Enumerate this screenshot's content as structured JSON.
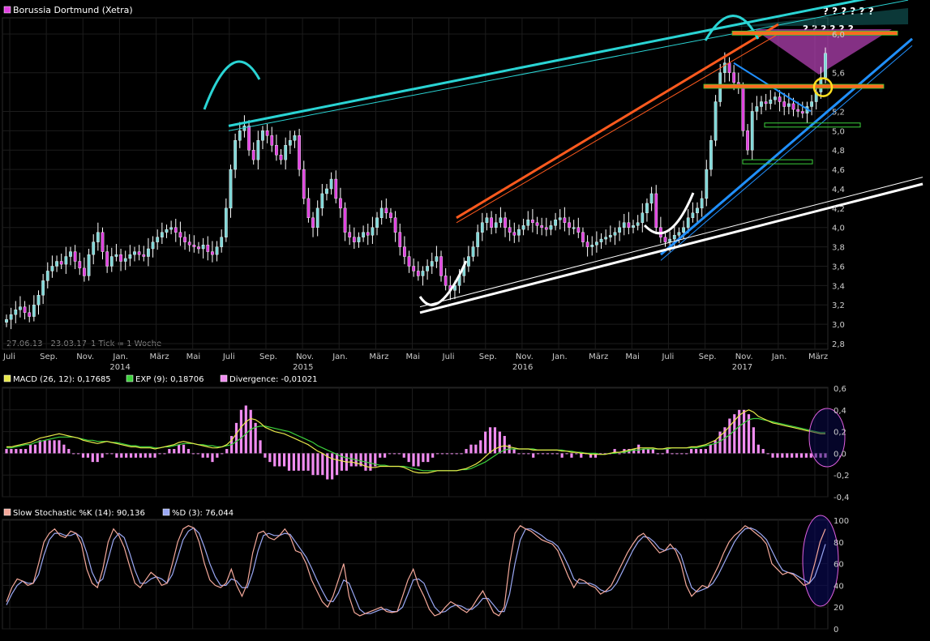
{
  "chart_data": [
    {
      "type": "candlestick",
      "title": "Borussia Dortmund (Xetra)",
      "range_label": "27.06.13 - 23.03.17",
      "tick_label": "1 Tick = 1 Woche",
      "ylim": [
        2.8,
        6.1
      ],
      "y_ticks": [
        "2,8",
        "3,0",
        "3,2",
        "3,4",
        "3,6",
        "3,8",
        "4,0",
        "4,2",
        "4,4",
        "4,6",
        "4,8",
        "5,0",
        "5,2",
        "5,6",
        "6,0"
      ],
      "x_ticks": [
        "Juli",
        "Sep.",
        "Nov.",
        "Jan.",
        "März",
        "Mai",
        "Juli",
        "Sep.",
        "Nov.",
        "Jan.",
        "März",
        "Mai",
        "Juli",
        "Sep.",
        "Nov.",
        "Jan.",
        "März",
        "Mai",
        "Juli",
        "Sep.",
        "Nov.",
        "Jan.",
        "März"
      ],
      "year_labels": [
        {
          "label": "2014",
          "tick": 3
        },
        {
          "label": "2015",
          "tick": 8
        },
        {
          "label": "2016",
          "tick": 14
        },
        {
          "label": "2017",
          "tick": 20
        }
      ],
      "annotations": [
        "? ? ? ? ? ?",
        "? ? ? ? ? ?"
      ],
      "colors": {
        "up": "#7fd8d8",
        "down": "#e040e0",
        "wick": "#ffffff"
      },
      "series": [
        {
          "name": "close",
          "values": [
            3.05,
            3.1,
            3.15,
            3.18,
            3.12,
            3.08,
            3.2,
            3.3,
            3.45,
            3.55,
            3.6,
            3.65,
            3.62,
            3.7,
            3.75,
            3.65,
            3.58,
            3.5,
            3.72,
            3.85,
            3.95,
            3.75,
            3.6,
            3.7,
            3.72,
            3.65,
            3.68,
            3.72,
            3.75,
            3.72,
            3.7,
            3.78,
            3.85,
            3.9,
            3.95,
            3.98,
            4.0,
            3.95,
            3.9,
            3.85,
            3.82,
            3.8,
            3.78,
            3.82,
            3.75,
            3.72,
            3.8,
            3.9,
            4.2,
            4.6,
            4.9,
            5.0,
            5.05,
            4.8,
            4.7,
            4.9,
            5.0,
            4.95,
            4.85,
            4.75,
            4.7,
            4.85,
            4.9,
            4.95,
            4.6,
            4.3,
            4.1,
            4.0,
            4.2,
            4.35,
            4.4,
            4.5,
            4.3,
            4.2,
            3.95,
            3.9,
            3.85,
            3.9,
            3.95,
            3.92,
            4.0,
            4.1,
            4.2,
            4.15,
            4.1,
            3.95,
            3.8,
            3.7,
            3.6,
            3.55,
            3.5,
            3.55,
            3.6,
            3.65,
            3.7,
            3.5,
            3.4,
            3.35,
            3.4,
            3.5,
            3.6,
            3.7,
            3.8,
            3.95,
            4.05,
            4.1,
            4.0,
            4.05,
            4.1,
            4.0,
            3.95,
            3.92,
            3.98,
            4.02,
            4.08,
            4.05,
            4.02,
            4.0,
            3.98,
            4.02,
            4.08,
            4.1,
            4.05,
            4.0,
            4.0,
            3.95,
            3.85,
            3.8,
            3.82,
            3.85,
            3.88,
            3.9,
            3.92,
            3.95,
            4.0,
            4.05,
            4.0,
            4.02,
            4.05,
            4.15,
            4.25,
            4.35,
            4.0,
            3.9,
            3.85,
            3.88,
            3.92,
            3.95,
            4.0,
            4.1,
            4.15,
            4.2,
            4.3,
            4.6,
            4.9,
            5.3,
            5.6,
            5.7,
            5.6,
            5.5,
            5.45,
            5.0,
            4.8,
            5.2,
            5.25,
            5.3,
            5.28,
            5.32,
            5.35,
            5.3,
            5.25,
            5.28,
            5.22,
            5.2,
            5.18,
            5.25,
            5.3,
            5.4,
            5.55,
            5.8
          ]
        }
      ],
      "trend_lines": [
        "cyan resistance",
        "orange channel",
        "blue support",
        "white long-term support"
      ]
    },
    {
      "type": "line",
      "title": "MACD",
      "legend": [
        {
          "label": "MACD (26, 12): 0,17685",
          "color": "#e8e84a"
        },
        {
          "label": "EXP (9): 0,18706",
          "color": "#3cd23c"
        },
        {
          "label": "Divergence: -0,01021",
          "color": "#f08cf0"
        }
      ],
      "ylim": [
        -0.4,
        0.6
      ],
      "y_ticks": [
        "0,6",
        "0,4",
        "0,2",
        "0,0",
        "-0,2",
        "-0,4"
      ],
      "series": [
        {
          "name": "MACD",
          "values": [
            0.06,
            0.06,
            0.07,
            0.08,
            0.09,
            0.1,
            0.12,
            0.14,
            0.15,
            0.16,
            0.17,
            0.18,
            0.17,
            0.16,
            0.15,
            0.14,
            0.12,
            0.11,
            0.1,
            0.09,
            0.1,
            0.11,
            0.1,
            0.09,
            0.08,
            0.07,
            0.06,
            0.06,
            0.05,
            0.05,
            0.05,
            0.04,
            0.05,
            0.06,
            0.07,
            0.08,
            0.1,
            0.11,
            0.1,
            0.09,
            0.08,
            0.07,
            0.06,
            0.05,
            0.05,
            0.06,
            0.08,
            0.12,
            0.18,
            0.24,
            0.29,
            0.32,
            0.31,
            0.28,
            0.24,
            0.22,
            0.2,
            0.19,
            0.18,
            0.16,
            0.14,
            0.12,
            0.1,
            0.08,
            0.05,
            0.02,
            0.0,
            -0.03,
            -0.05,
            -0.06,
            -0.07,
            -0.08,
            -0.08,
            -0.09,
            -0.1,
            -0.12,
            -0.13,
            -0.13,
            -0.12,
            -0.12,
            -0.12,
            -0.12,
            -0.12,
            -0.13,
            -0.15,
            -0.17,
            -0.18,
            -0.18,
            -0.18,
            -0.17,
            -0.16,
            -0.16,
            -0.16,
            -0.16,
            -0.16,
            -0.15,
            -0.14,
            -0.12,
            -0.1,
            -0.07,
            -0.03,
            0.01,
            0.04,
            0.06,
            0.07,
            0.06,
            0.05,
            0.04,
            0.04,
            0.04,
            0.03,
            0.03,
            0.03,
            0.03,
            0.03,
            0.03,
            0.02,
            0.02,
            0.01,
            0.01,
            0.0,
            0.0,
            -0.01,
            -0.01,
            -0.01,
            -0.01,
            0.0,
            0.01,
            0.01,
            0.02,
            0.03,
            0.04,
            0.05,
            0.05,
            0.05,
            0.05,
            0.04,
            0.04,
            0.05,
            0.05,
            0.05,
            0.05,
            0.05,
            0.06,
            0.06,
            0.07,
            0.08,
            0.1,
            0.12,
            0.16,
            0.2,
            0.25,
            0.3,
            0.35,
            0.38,
            0.4,
            0.38,
            0.34,
            0.32,
            0.3,
            0.28,
            0.27,
            0.26,
            0.25,
            0.24,
            0.23,
            0.22,
            0.21,
            0.2,
            0.19,
            0.18,
            0.18
          ]
        },
        {
          "name": "EXP",
          "values": [
            0.05,
            0.05,
            0.06,
            0.07,
            0.08,
            0.08,
            0.1,
            0.11,
            0.12,
            0.13,
            0.14,
            0.15,
            0.15,
            0.15,
            0.15,
            0.14,
            0.13,
            0.12,
            0.12,
            0.11,
            0.11,
            0.11,
            0.1,
            0.1,
            0.09,
            0.08,
            0.07,
            0.07,
            0.06,
            0.06,
            0.06,
            0.05,
            0.05,
            0.06,
            0.06,
            0.07,
            0.08,
            0.09,
            0.09,
            0.09,
            0.08,
            0.08,
            0.07,
            0.07,
            0.06,
            0.06,
            0.07,
            0.08,
            0.11,
            0.14,
            0.18,
            0.22,
            0.24,
            0.25,
            0.25,
            0.24,
            0.23,
            0.22,
            0.21,
            0.2,
            0.18,
            0.16,
            0.14,
            0.12,
            0.1,
            0.07,
            0.05,
            0.03,
            0.01,
            -0.01,
            -0.03,
            -0.04,
            -0.05,
            -0.06,
            -0.07,
            -0.08,
            -0.09,
            -0.1,
            -0.11,
            -0.11,
            -0.12,
            -0.12,
            -0.12,
            -0.12,
            -0.13,
            -0.14,
            -0.15,
            -0.16,
            -0.16,
            -0.16,
            -0.16,
            -0.16,
            -0.16,
            -0.16,
            -0.16,
            -0.15,
            -0.15,
            -0.14,
            -0.12,
            -0.1,
            -0.08,
            -0.05,
            -0.02,
            0.01,
            0.03,
            0.04,
            0.04,
            0.04,
            0.04,
            0.04,
            0.04,
            0.03,
            0.03,
            0.03,
            0.03,
            0.03,
            0.03,
            0.02,
            0.02,
            0.01,
            0.01,
            0.0,
            0.0,
            0.0,
            -0.01,
            -0.01,
            0.0,
            0.0,
            0.01,
            0.01,
            0.02,
            0.03,
            0.03,
            0.04,
            0.04,
            0.04,
            0.04,
            0.04,
            0.04,
            0.05,
            0.05,
            0.05,
            0.05,
            0.05,
            0.05,
            0.06,
            0.07,
            0.08,
            0.09,
            0.11,
            0.14,
            0.17,
            0.21,
            0.25,
            0.28,
            0.31,
            0.32,
            0.32,
            0.31,
            0.3,
            0.29,
            0.28,
            0.27,
            0.26,
            0.25,
            0.24,
            0.23,
            0.22,
            0.21,
            0.2,
            0.19,
            0.19
          ]
        }
      ]
    },
    {
      "type": "line",
      "title": "Slow Stochastic",
      "legend": [
        {
          "label": "Slow Stochastic %K (14): 90,136",
          "color": "#f4a89a"
        },
        {
          "label": "%D (3): 76,044",
          "color": "#9aa8f4"
        }
      ],
      "ylim": [
        0,
        100
      ],
      "y_ticks": [
        "100",
        "80",
        "60",
        "40",
        "20",
        "0"
      ],
      "series": [
        {
          "name": "%K",
          "values": [
            25,
            38,
            46,
            44,
            40,
            42,
            60,
            80,
            88,
            92,
            86,
            84,
            90,
            88,
            78,
            55,
            42,
            38,
            55,
            80,
            92,
            86,
            75,
            58,
            42,
            38,
            45,
            52,
            48,
            40,
            42,
            60,
            80,
            92,
            95,
            93,
            80,
            60,
            45,
            40,
            38,
            42,
            55,
            40,
            30,
            42,
            70,
            88,
            90,
            84,
            82,
            86,
            92,
            85,
            72,
            70,
            60,
            45,
            35,
            25,
            20,
            30,
            45,
            60,
            30,
            15,
            12,
            14,
            16,
            18,
            20,
            16,
            15,
            16,
            30,
            45,
            55,
            40,
            30,
            18,
            12,
            14,
            20,
            25,
            22,
            18,
            15,
            20,
            28,
            35,
            25,
            15,
            12,
            20,
            60,
            88,
            95,
            92,
            90,
            86,
            82,
            80,
            78,
            72,
            60,
            48,
            38,
            46,
            44,
            40,
            38,
            32,
            35,
            40,
            50,
            60,
            70,
            78,
            85,
            88,
            82,
            76,
            70,
            72,
            78,
            72,
            60,
            40,
            30,
            35,
            40,
            38,
            48,
            58,
            70,
            80,
            86,
            90,
            95,
            92,
            88,
            84,
            78,
            60,
            55,
            50,
            52,
            50,
            45,
            40,
            42,
            60,
            80,
            92
          ]
        },
        {
          "name": "%D",
          "values": [
            22,
            32,
            40,
            44,
            42,
            42,
            50,
            68,
            82,
            88,
            88,
            86,
            86,
            88,
            84,
            70,
            52,
            42,
            46,
            64,
            82,
            88,
            84,
            70,
            54,
            42,
            42,
            46,
            48,
            46,
            42,
            50,
            66,
            82,
            90,
            93,
            88,
            75,
            60,
            48,
            40,
            40,
            46,
            44,
            38,
            38,
            52,
            72,
            86,
            88,
            86,
            86,
            88,
            87,
            80,
            73,
            66,
            56,
            45,
            35,
            26,
            25,
            33,
            45,
            42,
            30,
            18,
            14,
            14,
            16,
            18,
            18,
            16,
            16,
            20,
            32,
            45,
            46,
            42,
            30,
            20,
            15,
            16,
            20,
            22,
            21,
            18,
            18,
            22,
            28,
            28,
            22,
            16,
            16,
            32,
            60,
            82,
            92,
            92,
            89,
            86,
            82,
            80,
            76,
            68,
            58,
            46,
            42,
            42,
            42,
            40,
            36,
            34,
            36,
            42,
            52,
            62,
            72,
            80,
            85,
            84,
            80,
            74,
            72,
            74,
            74,
            68,
            52,
            38,
            34,
            36,
            38,
            42,
            50,
            60,
            70,
            80,
            87,
            92,
            93,
            91,
            87,
            82,
            72,
            62,
            54,
            52,
            51,
            48,
            45,
            42,
            48,
            62,
            78
          ]
        }
      ]
    }
  ]
}
